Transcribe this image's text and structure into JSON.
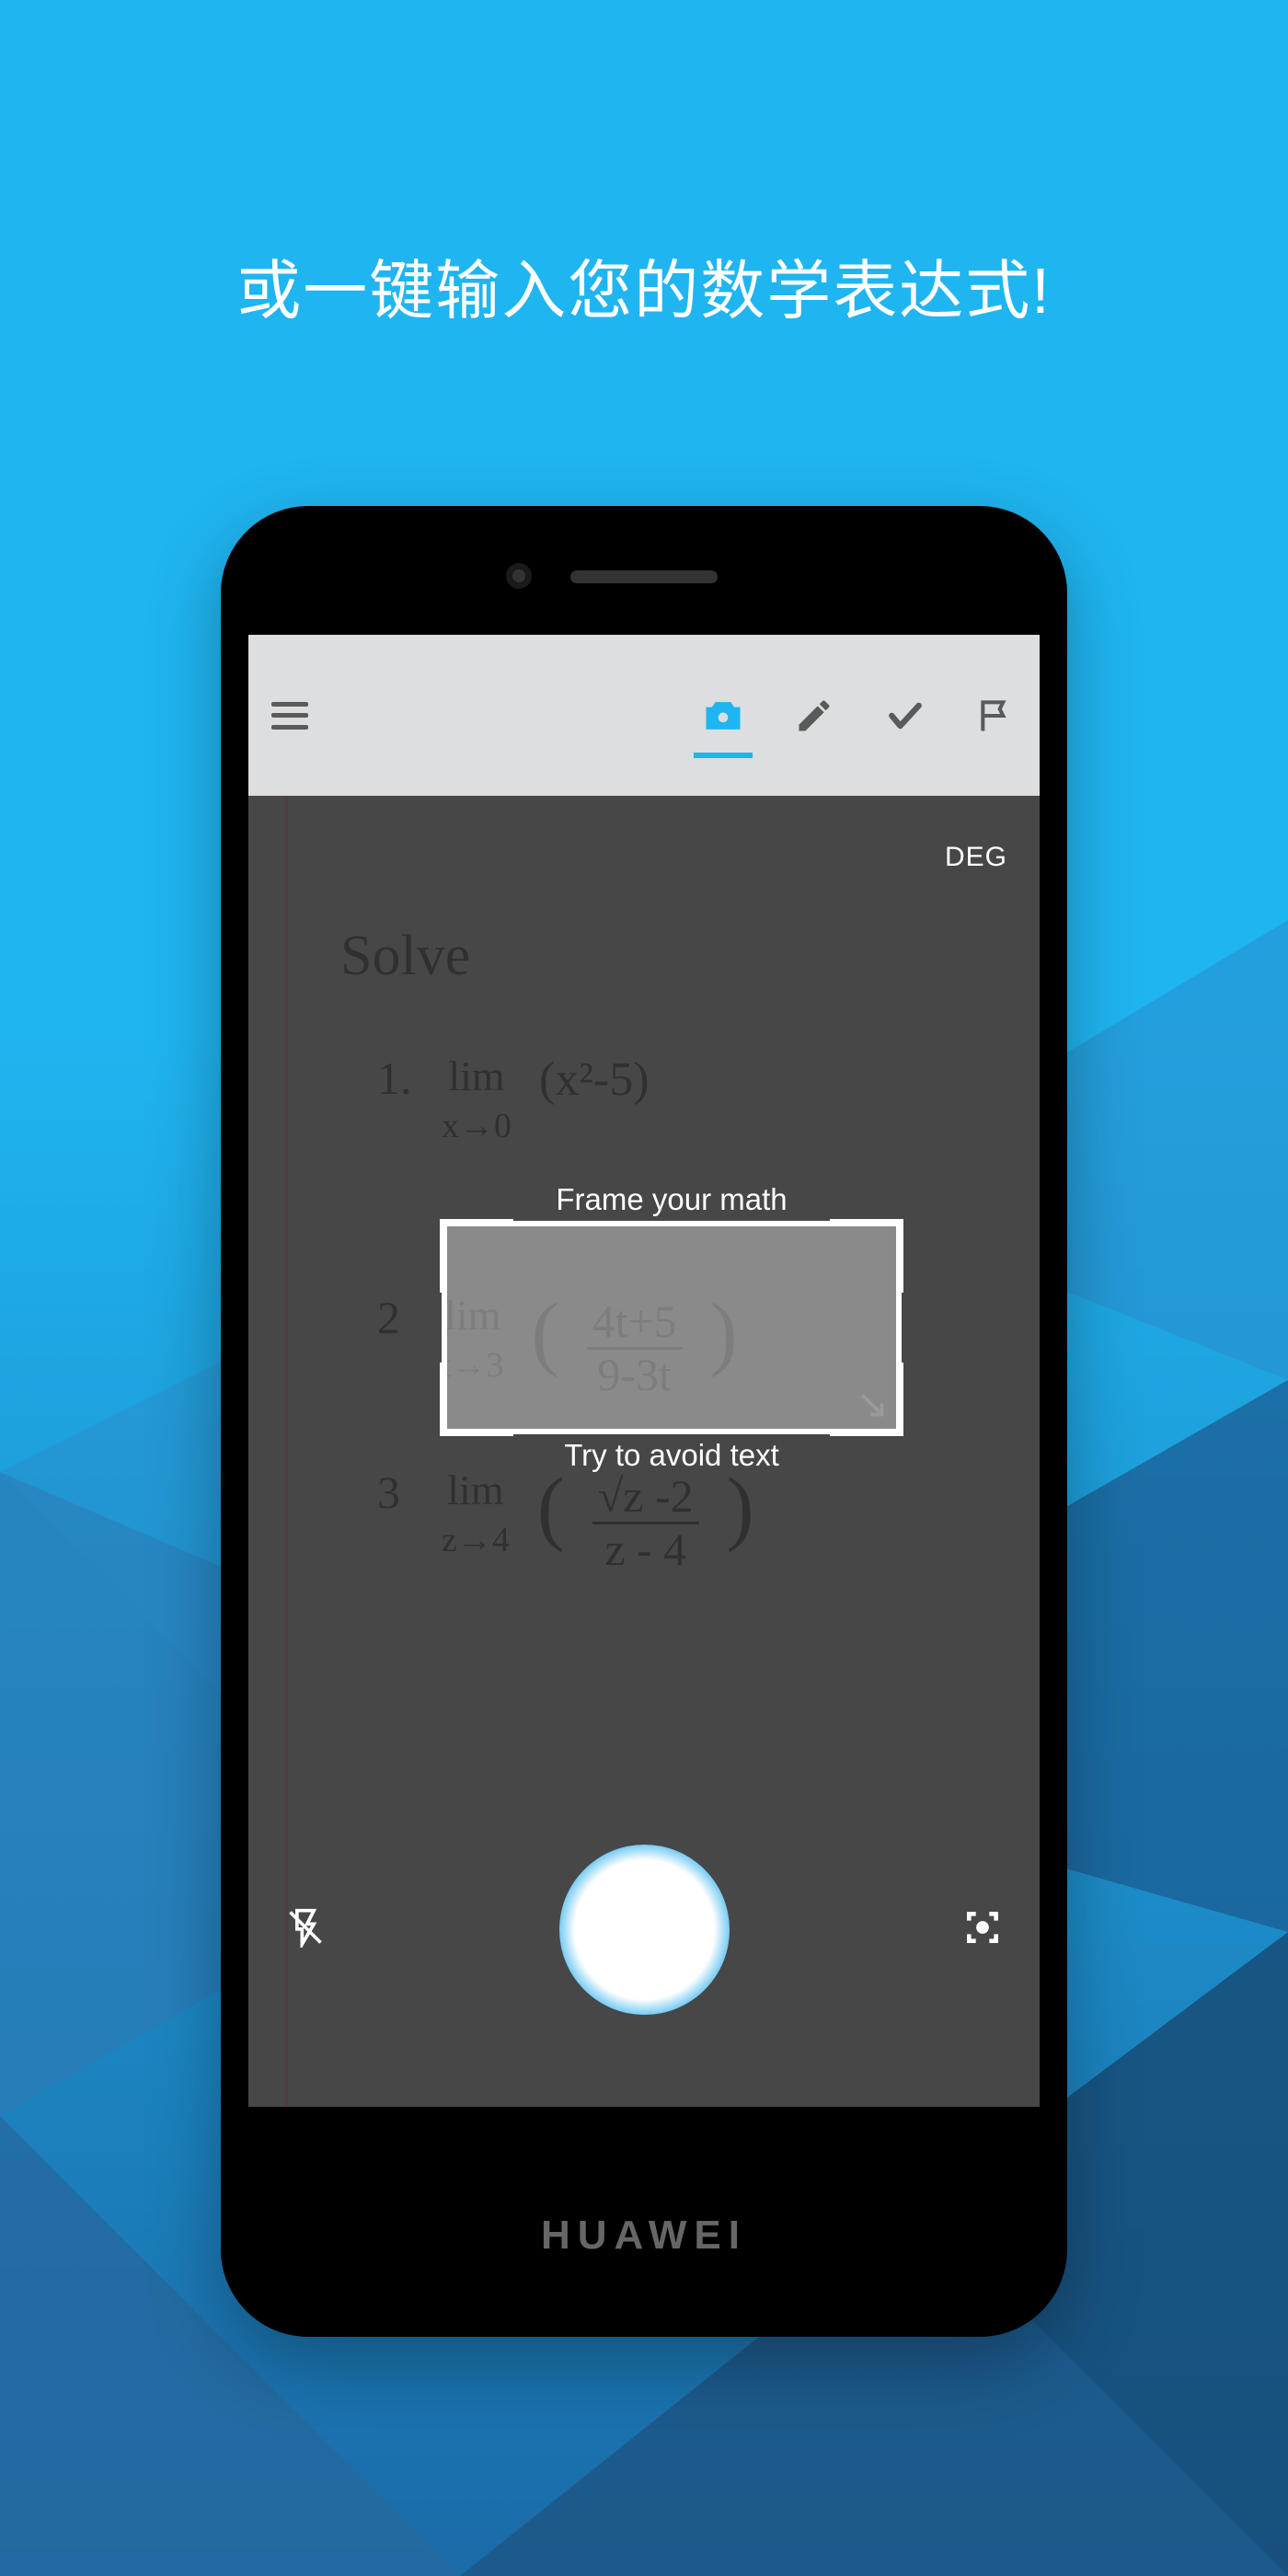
{
  "headline": "或一键输入您的数学表达式!",
  "toolbar": {
    "menu_icon": "hamburger-icon",
    "tabs": {
      "camera": "camera-icon",
      "edit": "pencil-icon",
      "check": "check-icon",
      "flag": "flag-icon"
    },
    "active_tab": "camera"
  },
  "viewport": {
    "angle_mode": "DEG",
    "crop_hint_top": "Frame your math",
    "crop_hint_bottom": "Try to avoid text",
    "handwriting": {
      "title": "Solve",
      "problems": [
        {
          "n": "1.",
          "lim": "lim",
          "sub": "x→0",
          "expr": "(x²-5)"
        },
        {
          "n": "2",
          "lim": "lim",
          "sub": "t→3",
          "frac_num": "4t+5",
          "frac_den": "9-3t"
        },
        {
          "n": "3",
          "lim": "lim",
          "sub": "z→4",
          "frac_num": "√z -2",
          "frac_den": "z - 4"
        }
      ]
    },
    "controls": {
      "flash": "off",
      "focus_icon": "focus-target-icon"
    }
  },
  "device_brand": "HUAWEI",
  "colors": {
    "accent": "#1FB5F0",
    "bg_top": "#1FB5F0",
    "bg_bottom": "#1a6ba8"
  }
}
